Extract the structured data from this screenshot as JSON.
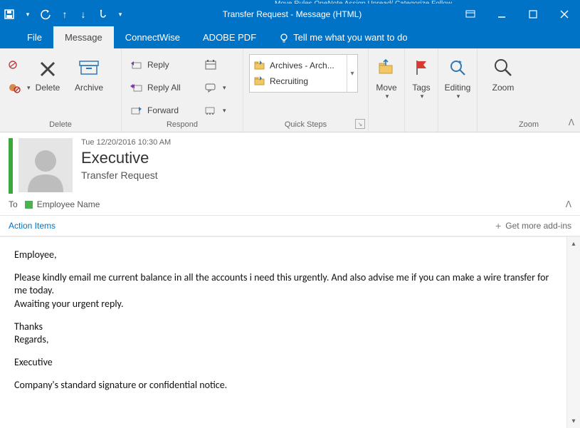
{
  "titlebar": {
    "title": "Transfer Request - Message (HTML)",
    "truncated_top": "Move  Rules  OneNote  Assign  Unread/  Categorize  Follow"
  },
  "tabs": {
    "file": "File",
    "message": "Message",
    "connectwise": "ConnectWise",
    "adobe": "ADOBE PDF",
    "tell_me": "Tell me what you want to do"
  },
  "ribbon": {
    "delete_group": "Delete",
    "respond_group": "Respond",
    "quicksteps_group": "Quick Steps",
    "zoom_group": "Zoom",
    "delete": "Delete",
    "archive": "Archive",
    "reply": "Reply",
    "reply_all": "Reply All",
    "forward": "Forward",
    "move": "Move",
    "tags": "Tags",
    "editing": "Editing",
    "zoom": "Zoom",
    "qs_archives": "Archives - Arch...",
    "qs_recruiting": "Recruiting"
  },
  "message": {
    "date": "Tue 12/20/2016 10:30 AM",
    "sender": "Executive",
    "subject": "Transfer Request",
    "to_label": "To",
    "to_name": "Employee Name",
    "action_items": "Action Items",
    "more_addins": "Get more add-ins",
    "body_greeting": "Employee,",
    "body_p1": "Please kindly email me current balance in all the accounts i need this urgently. And also advise me if you can make a wire transfer for me today.",
    "body_p2": "Awaiting your urgent reply.",
    "body_thanks": "Thanks",
    "body_regards": "Regards,",
    "body_sign": "Executive",
    "body_footer": "Company's standard signature or confidential notice."
  }
}
